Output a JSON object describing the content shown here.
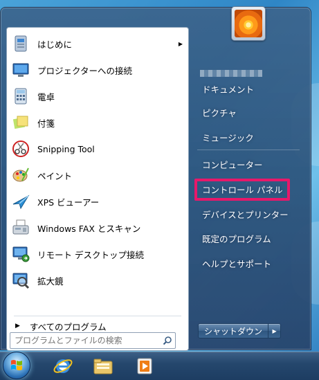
{
  "programs": [
    {
      "label": "はじめに",
      "icon": "getting-started-icon",
      "has_submenu": true
    },
    {
      "label": "プロジェクターへの接続",
      "icon": "projector-icon"
    },
    {
      "label": "電卓",
      "icon": "calculator-icon"
    },
    {
      "label": "付箋",
      "icon": "sticky-notes-icon"
    },
    {
      "label": "Snipping Tool",
      "icon": "scissors-icon"
    },
    {
      "label": "ペイント",
      "icon": "paint-palette-icon"
    },
    {
      "label": "XPS ビューアー",
      "icon": "xps-viewer-icon"
    },
    {
      "label": "Windows FAX とスキャン",
      "icon": "fax-icon"
    },
    {
      "label": "リモート デスクトップ接続",
      "icon": "remote-desktop-icon"
    },
    {
      "label": "拡大鏡",
      "icon": "magnifier-icon"
    }
  ],
  "all_programs": "すべてのプログラム",
  "search": {
    "placeholder": "プログラムとファイルの検索"
  },
  "right_links": {
    "documents": "ドキュメント",
    "pictures": "ピクチャ",
    "music": "ミュージック",
    "computer": "コンピューター",
    "control_panel": "コントロール パネル",
    "devices": "デバイスとプリンター",
    "default_programs": "既定のプログラム",
    "help": "ヘルプとサポート"
  },
  "shutdown": {
    "label": "シャットダウン"
  },
  "colors": {
    "highlight": "#e8186a",
    "menu_bg": "#2d557d",
    "taskbar": "#1d3d62"
  },
  "taskbar_icons": [
    "windows-orb-icon",
    "internet-explorer-icon",
    "file-explorer-icon",
    "media-player-icon"
  ]
}
